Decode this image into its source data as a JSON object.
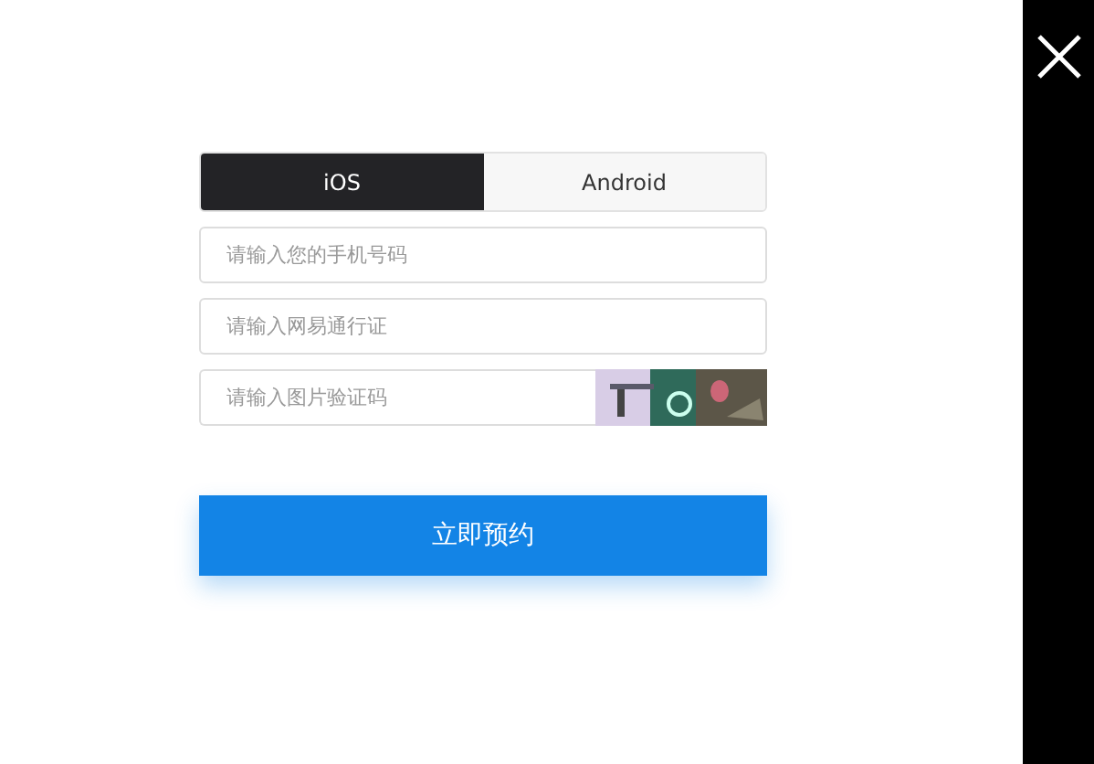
{
  "tabs": [
    {
      "label": "iOS",
      "selected": true
    },
    {
      "label": "Android",
      "selected": false
    }
  ],
  "fields": [
    {
      "placeholder": "请输入您的手机号码"
    },
    {
      "placeholder": "请输入网易通行证"
    },
    {
      "placeholder": "请输入图片验证码"
    }
  ],
  "submit": {
    "label": "立即预约"
  }
}
